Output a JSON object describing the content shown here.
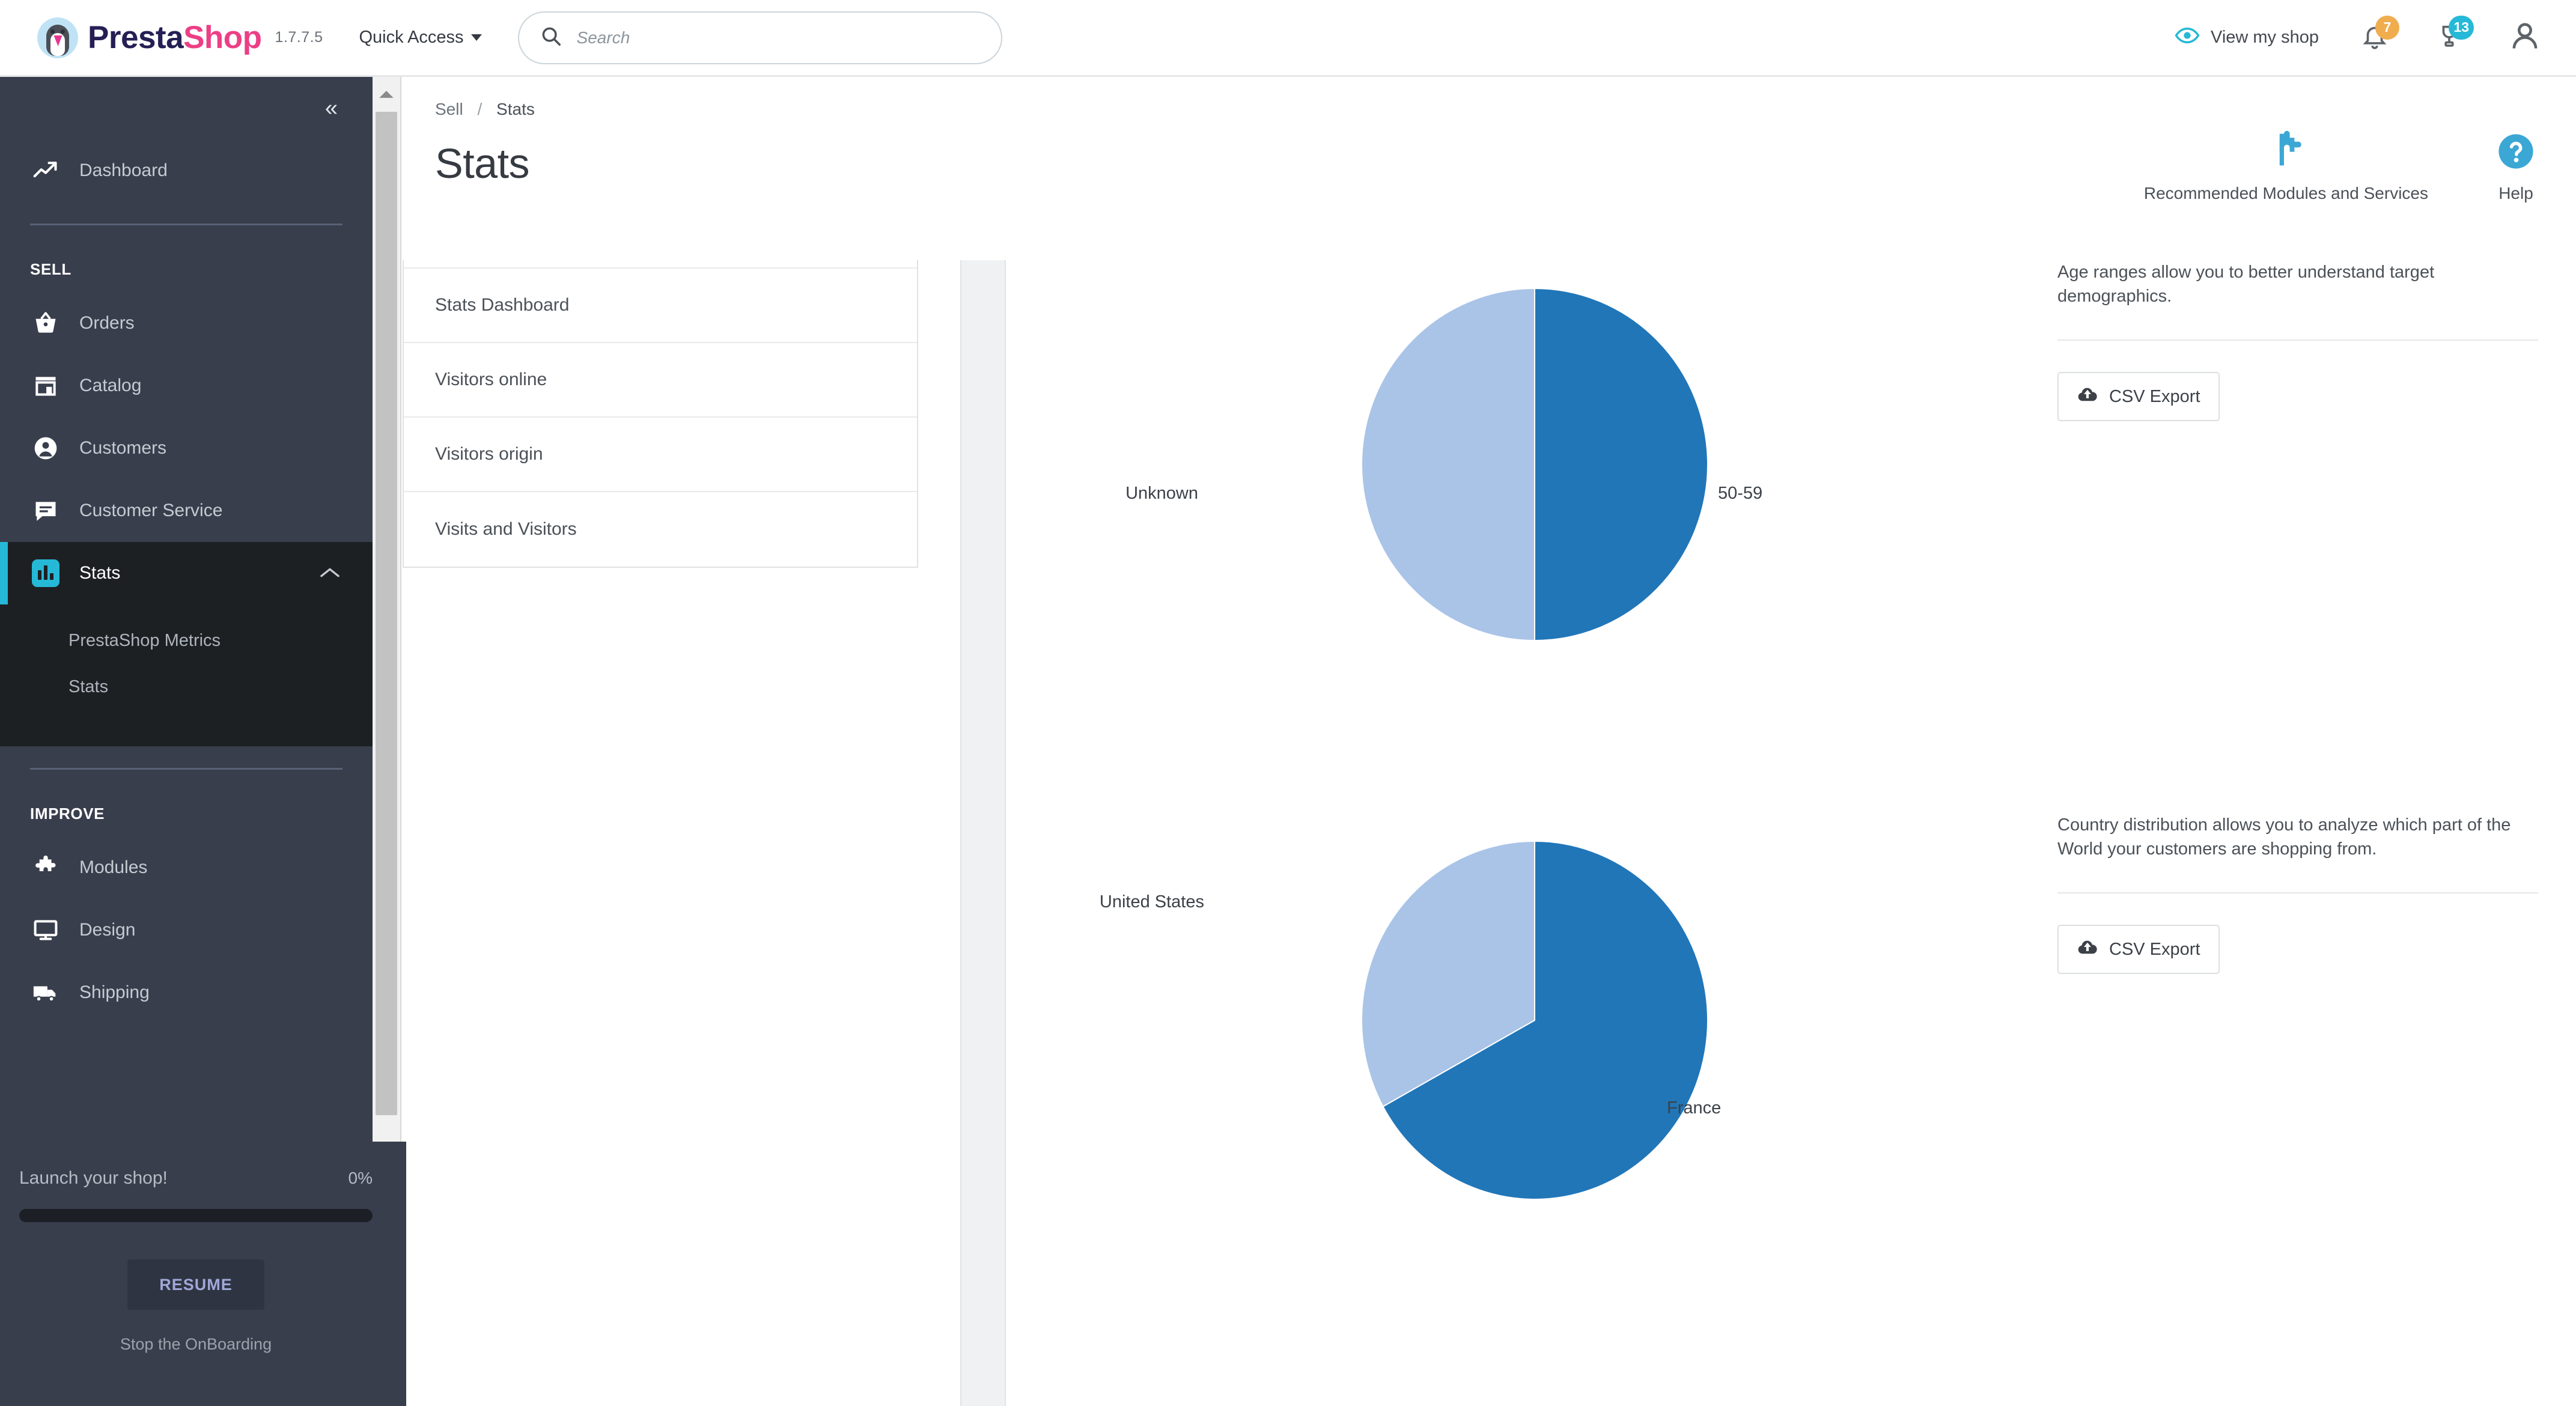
{
  "header": {
    "brand_presta": "Presta",
    "brand_shop": "Shop",
    "version": "1.7.7.5",
    "quick_access": "Quick Access",
    "search_placeholder": "Search",
    "search_value": "",
    "view_my_shop": "View my shop",
    "notifications_badge": "7",
    "orders_badge": "13",
    "colors": {
      "brand_pink": "#ec3f85",
      "brand_navy": "#251f55",
      "accent_cyan": "#25b9d7",
      "badge_orange": "#f0ad4e"
    }
  },
  "sidebar": {
    "collapse_label": "«",
    "dashboard": {
      "label": "Dashboard",
      "icon": "trending-up-icon"
    },
    "sections": [
      {
        "title": "SELL",
        "items": [
          {
            "label": "Orders",
            "icon": "basket-icon"
          },
          {
            "label": "Catalog",
            "icon": "store-icon"
          },
          {
            "label": "Customers",
            "icon": "customer-icon"
          },
          {
            "label": "Customer Service",
            "icon": "chat-icon"
          },
          {
            "label": "Stats",
            "icon": "bar-chart-icon",
            "active": true,
            "expanded": true,
            "submenu": [
              {
                "label": "PrestaShop Metrics"
              },
              {
                "label": "Stats"
              }
            ]
          }
        ]
      },
      {
        "title": "IMPROVE",
        "items": [
          {
            "label": "Modules",
            "icon": "puzzle-icon"
          },
          {
            "label": "Design",
            "icon": "monitor-icon"
          },
          {
            "label": "Shipping",
            "icon": "truck-icon"
          }
        ]
      }
    ]
  },
  "onboarding": {
    "title": "Launch your shop!",
    "percent": "0%",
    "progress_value": 0,
    "resume_label": "RESUME",
    "stop_label": "Stop the OnBoarding"
  },
  "page": {
    "breadcrumb_parent": "Sell",
    "breadcrumb_separator": "/",
    "breadcrumb_current": "Stats",
    "title": "Stats"
  },
  "toolbar": {
    "modules_label": "Recommended Modules and Services",
    "help_label": "Help"
  },
  "stats_nav": {
    "items": [
      {
        "label": "Stats Dashboard"
      },
      {
        "label": "Visitors online"
      },
      {
        "label": "Visitors origin"
      },
      {
        "label": "Visits and Visitors"
      }
    ]
  },
  "panels": [
    {
      "description": "Age ranges allow you to better understand target demographics.",
      "csv_label": "CSV Export"
    },
    {
      "description": "Country distribution allows you to analyze which part of the World your customers are shopping from.",
      "csv_label": "CSV Export"
    }
  ],
  "chart_data": [
    {
      "type": "pie",
      "title": "Age ranges",
      "labels": [
        "50-59",
        "Unknown"
      ],
      "values": [
        50,
        50
      ],
      "colors": [
        "#2176b8",
        "#aac4e8"
      ],
      "start_angle_deg": 0,
      "label_positions": [
        "right",
        "left"
      ],
      "legend": "none"
    },
    {
      "type": "pie",
      "title": "Country distribution",
      "labels": [
        "France",
        "United States"
      ],
      "values": [
        67,
        33
      ],
      "colors": [
        "#2176b8",
        "#aac4e8"
      ],
      "start_angle_deg": 0,
      "label_positions": [
        "right",
        "left"
      ],
      "legend": "none"
    }
  ]
}
